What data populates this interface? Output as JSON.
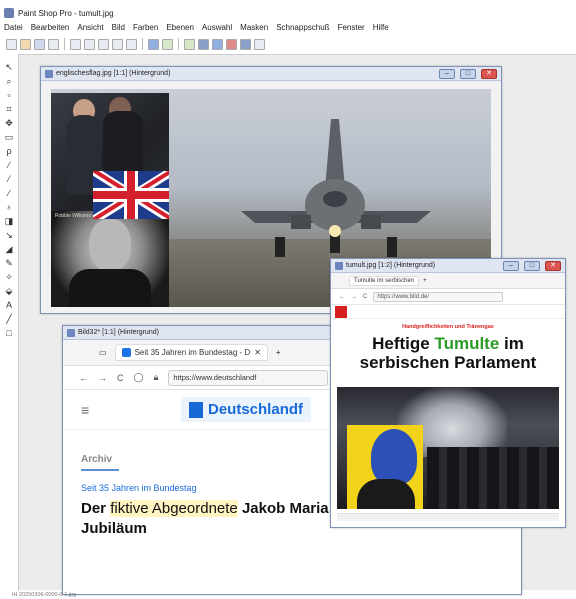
{
  "app": {
    "title": "Paint Shop Pro - tumult.jpg"
  },
  "menu": [
    "Datei",
    "Bearbeiten",
    "Ansicht",
    "Bild",
    "Farben",
    "Ebenen",
    "Auswahl",
    "Masken",
    "Schnappschuß",
    "Fenster",
    "Hilfe"
  ],
  "windows": {
    "england": {
      "title": "englischesflag.jpg [1:1] (Hintergrund)",
      "caption": "Robbie Williams"
    },
    "bild": {
      "title": "Bild32* [1:1] (Hintergrund)",
      "tab_label": "Seit 35 Jahren im Bundestag - D",
      "url": "https://www.deutschlandf",
      "brand": "Deutschlandf",
      "kicker": "Archiv",
      "dachzeile": "Seit 35 Jahren im Bundestag",
      "headline_pre": "Der ",
      "headline_mark": "fiktive Abgeordnete",
      "headline_post": " Jakob Maria Mierscheid fei-ert Jubiläum"
    },
    "tumult": {
      "title": "tumult.jpg [1:2] (Hintergrund)",
      "tab_label": "Tumulte im serbischen",
      "url": "https://www.bild.de/",
      "kicker": "Handgreiflichkeiten und Tränengas",
      "headline_pre": "Heftige ",
      "headline_hl": "Tumulte",
      "headline_post": " im serbischen Parlament"
    }
  },
  "footer": "IH 20250306-0000-0-1.jpg"
}
